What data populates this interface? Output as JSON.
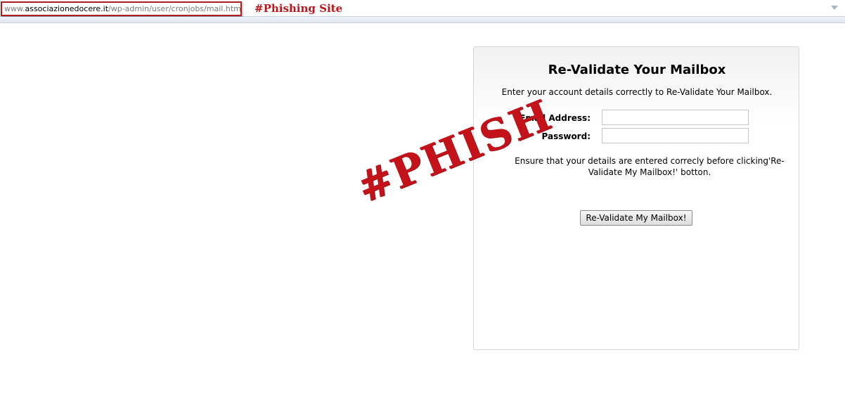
{
  "address_bar": {
    "url_prefix": "www.",
    "url_domain": "associazionedocere.it",
    "url_path": "/wp-admin/user/cronjobs/mail.htm",
    "annotation": "#Phishing Site",
    "dropdown_icon": "chevron-down-icon"
  },
  "form": {
    "title": "Re-Validate Your Mailbox",
    "subtitle": "Enter your account details correctly to Re-Validate Your Mailbox.",
    "email_label": "Email Address:",
    "email_value": "",
    "password_label": "Password:",
    "password_value": "",
    "notice": "Ensure that your details are entered correcly before clicking'Re-Validate My Mailbox!' botton.",
    "submit_label": "Re-Validate My Mailbox!"
  },
  "stamp": {
    "text": "#PHISH"
  },
  "colors": {
    "annotation_red": "#c0141c",
    "url_box_border": "#b01d1d",
    "stamp_red": "#c4121b"
  }
}
